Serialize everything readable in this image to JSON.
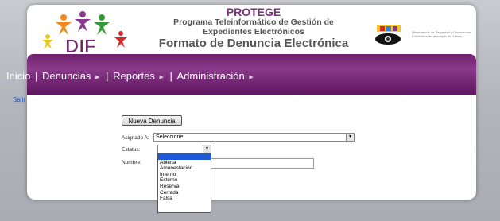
{
  "header": {
    "title": "PROTEGE",
    "subtitle_line1": "Programa Teleinformático de Gestión de",
    "subtitle_line2": "Expedientes Electrónicos",
    "form_title": "Formato de Denuncia Electrónica",
    "logo_text": "DIF",
    "partner_logo_text": "Observatorio de Seguridad y Convivencia Ciudadana del municipio de Juárez"
  },
  "nav": {
    "items": [
      {
        "label": "Inicio"
      },
      {
        "label": "Denuncias"
      },
      {
        "label": "Reportes"
      },
      {
        "label": "Administración"
      }
    ],
    "separator": "|"
  },
  "salir_label": "Salir",
  "form": {
    "nueva_button": "Nueva Denuncia",
    "asignado_label": "Asignado A:",
    "asignado_value": "Seleccione",
    "estatus_label": "Estatus:",
    "estatus_value": "",
    "nombre_label": "Nombre:",
    "nombre_value": ""
  },
  "estatus_options": [
    "",
    "Abierta",
    "Amonestación",
    "Interno",
    "Externo",
    "Reserva",
    "Cerrada",
    "Falsa"
  ],
  "colors": {
    "nav_purple": "#6e1f6e",
    "title_purple": "#7a2f7a",
    "dropdown_highlight": "#1e58d6"
  }
}
